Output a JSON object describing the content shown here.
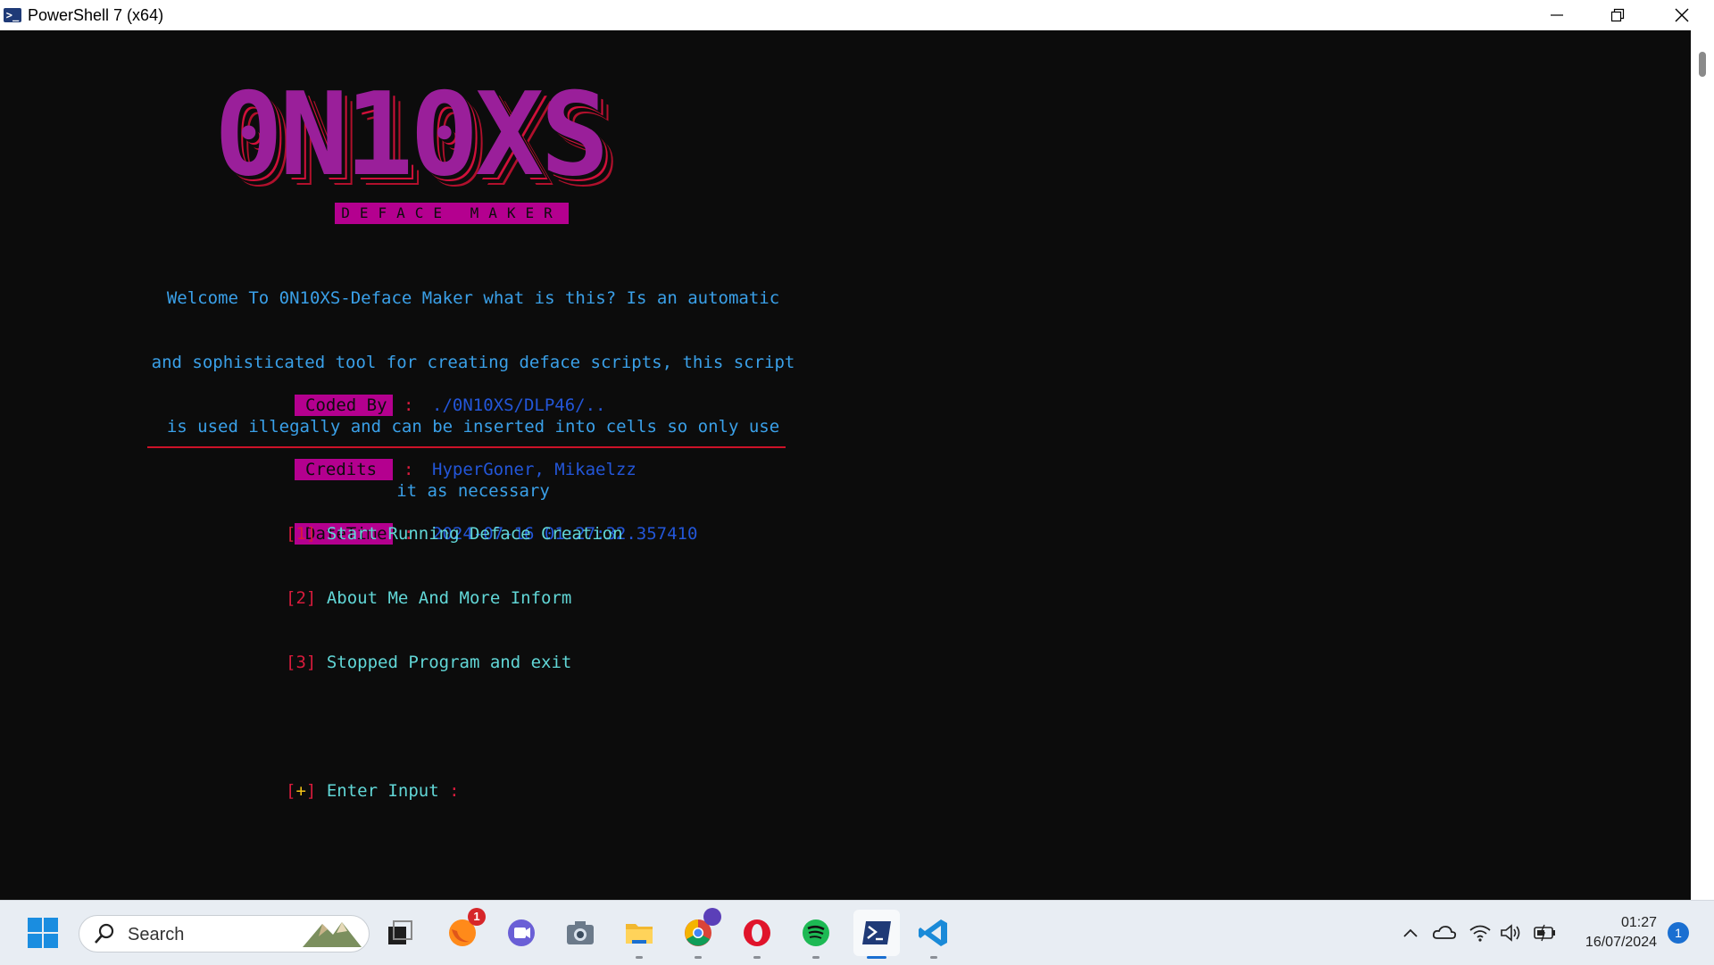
{
  "window": {
    "title": "PowerShell 7 (x64)"
  },
  "banner": {
    "word": "0N10XS",
    "subtitle": "DEFACE MAKER"
  },
  "description": [
    "Welcome To 0N10XS-Deface Maker what is this? Is an automatic",
    "and sophisticated tool for creating deface scripts, this script",
    "is used illegally and can be inserted into cells so only use",
    "it as necessary"
  ],
  "info": {
    "separator": ":",
    "rows": [
      {
        "label": "Coded By",
        "value": "./0N10XS/DLP46/.."
      },
      {
        "label": "Credits",
        "value": "HyperGoner, Mikaelzz"
      },
      {
        "label": "DateTime",
        "value": "2024-07-16 01:27:32.357410"
      }
    ]
  },
  "menu": {
    "items": [
      {
        "key": "1",
        "label": "Start Running Deface Creation"
      },
      {
        "key": "2",
        "label": "About Me And More Inform"
      },
      {
        "key": "3",
        "label": "Stopped Program and exit"
      }
    ],
    "prompt_key": "+",
    "prompt_label": "Enter Input",
    "prompt_sep": ":"
  },
  "colors": {
    "banner_fill": "#9a1f9a",
    "banner_outline": "#d0103a",
    "label_bg": "#b4008f",
    "desc_text": "#3aa0e8",
    "value_text": "#2356d8",
    "menu_text": "#61d6d6",
    "bracket": "#d81b3c",
    "plus": "#f2c318"
  },
  "taskbar": {
    "search_placeholder": "Search",
    "icons": [
      "start-icon",
      "search-icon",
      "task-view-icon",
      "firefox-icon",
      "chat-icon",
      "camera-icon",
      "file-explorer-icon",
      "chrome-icon",
      "opera-icon",
      "spotify-icon",
      "powershell-icon",
      "vscode-icon"
    ],
    "firefox_badge": "1",
    "tray_icons": [
      "chevron-up-icon",
      "cloud-icon",
      "wifi-icon",
      "volume-icon",
      "battery-icon"
    ],
    "time": "01:27",
    "date": "16/07/2024",
    "notification_count": "1"
  }
}
